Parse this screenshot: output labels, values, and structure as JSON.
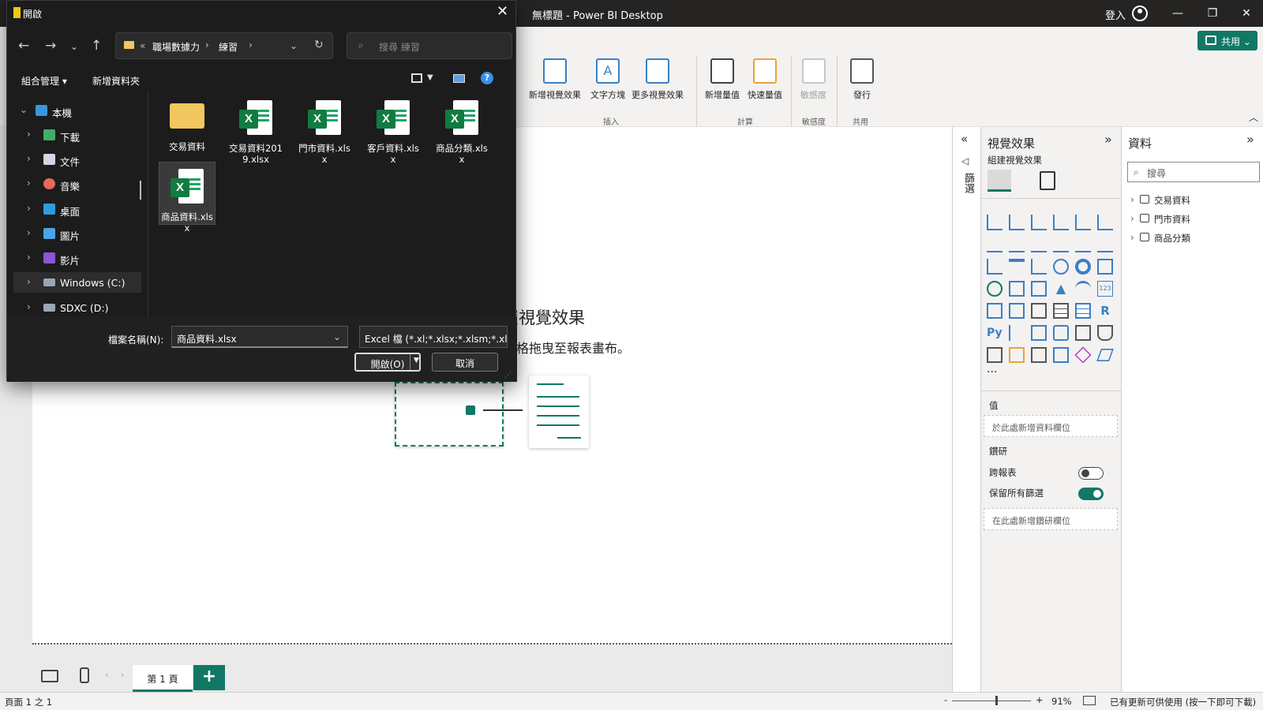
{
  "app": {
    "title": "無標題 - Power BI Desktop",
    "signin": "登入",
    "share_label": "共用",
    "brand_color": "#117865"
  },
  "ribbon": {
    "buttons": [
      {
        "label": "新增視覺效果"
      },
      {
        "label": "文字方塊"
      },
      {
        "label": "更多視覺效果"
      },
      {
        "label": "新增量值"
      },
      {
        "label": "快速量值"
      },
      {
        "label": "敏感度"
      },
      {
        "label": "發行"
      }
    ],
    "groups": [
      "插入",
      "計算",
      "敏感度",
      "共用"
    ]
  },
  "canvas": {
    "empty_title": "置視覺效果",
    "empty_subtitle": "格拖曳至報表畫布。"
  },
  "filters_strip": {
    "label": "篩選"
  },
  "viz_pane": {
    "title": "視覺效果",
    "subtitle": "組建視覺效果",
    "more": "···",
    "values_label": "值",
    "values_placeholder": "於此處新增資料欄位",
    "drillthrough_label": "鑽研",
    "cross_report_label": "跨報表",
    "cross_report_on": false,
    "keep_filters_label": "保留所有篩選",
    "keep_filters_on": true,
    "drill_placeholder": "在此處新增鑽研欄位"
  },
  "data_pane": {
    "title": "資料",
    "search_placeholder": "搜尋",
    "tables": [
      "交易資料",
      "門市資料",
      "商品分類"
    ]
  },
  "pages": {
    "tab_label": "第 1 頁",
    "add_label": "+"
  },
  "status": {
    "page_info": "頁面 1 之 1",
    "zoom": "91%",
    "zoom_fraction": 0.55,
    "update_msg": "已有更新可供使用 (按一下即可下載)"
  },
  "dialog": {
    "title": "開啟",
    "breadcrumb_prefix": "«",
    "breadcrumb": [
      "職場數據力",
      "練習"
    ],
    "search_placeholder": "搜尋 練習",
    "organize_label": "組合管理",
    "new_folder_label": "新增資料夾",
    "sidebar": [
      {
        "label": "本機",
        "icon": "pc-icon",
        "color": "#3a96dd"
      },
      {
        "label": "下載",
        "icon": "download-icon",
        "color": "#3fae6a"
      },
      {
        "label": "文件",
        "icon": "document-icon",
        "color": "#cfd8e3"
      },
      {
        "label": "音樂",
        "icon": "music-icon",
        "color": "#e8685a"
      },
      {
        "label": "桌面",
        "icon": "desktop-icon",
        "color": "#2f9ae0"
      },
      {
        "label": "圖片",
        "icon": "pictures-icon",
        "color": "#4aa3e8"
      },
      {
        "label": "影片",
        "icon": "videos-icon",
        "color": "#8b55d6"
      },
      {
        "label": "Windows (C:)",
        "icon": "drive-icon",
        "color": "#9aa7b4"
      },
      {
        "label": "SDXC (D:)",
        "icon": "sd-card-icon",
        "color": "#9aa7b4"
      }
    ],
    "files": [
      {
        "name": "交易資料",
        "type": "folder"
      },
      {
        "name": "交易資料2019.xlsx",
        "type": "excel"
      },
      {
        "name": "門市資料.xlsx",
        "type": "excel"
      },
      {
        "name": "客戶資料.xlsx",
        "type": "excel"
      },
      {
        "name": "商品分類.xlsx",
        "type": "excel"
      },
      {
        "name": "商品資料.xlsx",
        "type": "excel"
      }
    ],
    "filename_label": "檔案名稱(N):",
    "filename_value": "商品資料.xlsx",
    "filetype_value": "Excel 檔 (*.xl;*.xlsx;*.xlsm;*.xlsb",
    "open_label": "開啟(O)",
    "cancel_label": "取消"
  }
}
